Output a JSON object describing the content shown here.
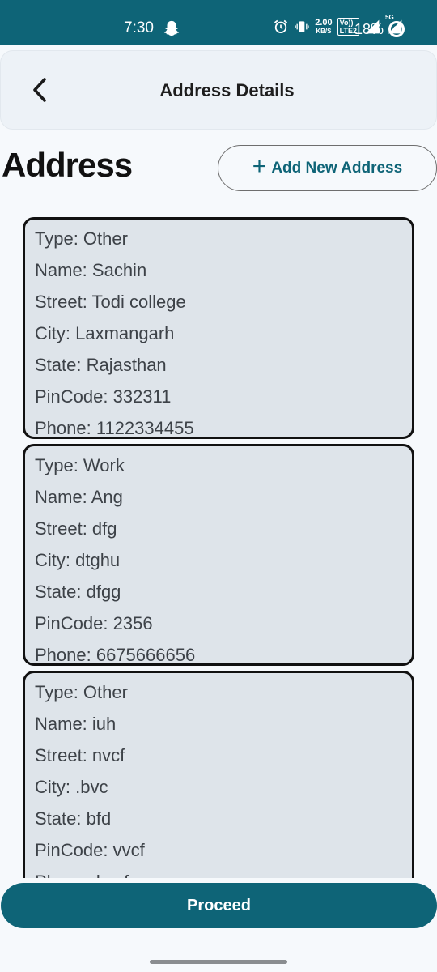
{
  "status_bar": {
    "time": "7:30",
    "net_speed_top": "2.00",
    "net_speed_bottom": "KB/S",
    "lte_top": "Vo))",
    "lte_bottom": "LTE2",
    "signal_label": "5G",
    "battery": "18%"
  },
  "header": {
    "title": "Address Details"
  },
  "section": {
    "title": "Address",
    "add_button_label": "Add New Address"
  },
  "addresses": [
    {
      "type": "Type: Other",
      "name": "Name: Sachin",
      "street": "Street: Todi college",
      "city": "City: Laxmangarh",
      "state": "State: Rajasthan",
      "pincode": "PinCode: 332311",
      "phone": "Phone: 1122334455"
    },
    {
      "type": "Type: Work",
      "name": "Name: Ang",
      "street": "Street: dfg",
      "city": "City: dtghu",
      "state": "State: dfgg",
      "pincode": "PinCode: 2356",
      "phone": "Phone: 6675666656"
    },
    {
      "type": "Type: Other",
      "name": "Name: iuh",
      "street": "Street: nvcf",
      "city": "City: .bvc",
      "state": "State: bfd",
      "pincode": "PinCode: vvcf",
      "phone": "Phone: bvcf"
    }
  ],
  "footer": {
    "proceed_label": "Proceed"
  }
}
